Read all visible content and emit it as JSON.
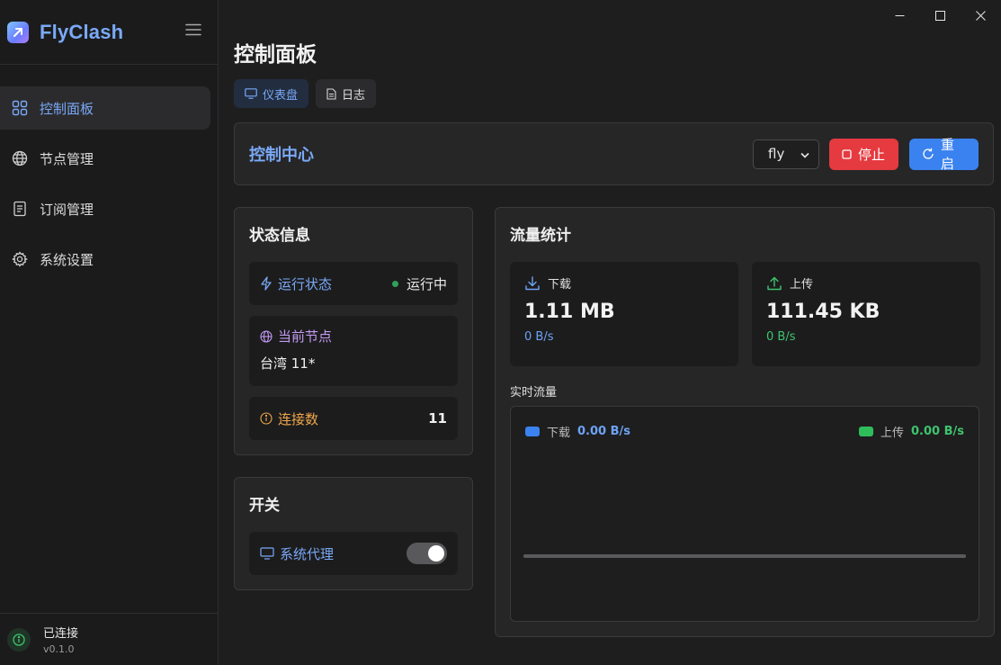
{
  "app": {
    "name": "FlyClash",
    "status": "已连接",
    "version": "v0.1.0"
  },
  "sidebar": {
    "items": [
      {
        "label": "控制面板",
        "icon": "grid-icon",
        "active": true
      },
      {
        "label": "节点管理",
        "icon": "globe-icon"
      },
      {
        "label": "订阅管理",
        "icon": "document-icon"
      },
      {
        "label": "系统设置",
        "icon": "gear-icon"
      }
    ]
  },
  "page": {
    "title": "控制面板"
  },
  "tabs": [
    {
      "label": "仪表盘",
      "active": true
    },
    {
      "label": "日志"
    }
  ],
  "control_center": {
    "title": "控制中心",
    "profile_selected": "fly",
    "stop_label": "停止",
    "restart_label": "重启",
    "colors": {
      "stop": "#e53a3f",
      "restart": "#3a82f0"
    }
  },
  "status": {
    "title": "状态信息",
    "run_state_label": "运行状态",
    "run_state_value": "运行中",
    "current_node_label": "当前节点",
    "current_node_value": "台湾 11*",
    "connections_label": "连接数",
    "connections_value": "11"
  },
  "switches": {
    "title": "开关",
    "system_proxy_label": "系统代理",
    "system_proxy_on": true
  },
  "traffic": {
    "title": "流量统计",
    "download": {
      "label": "下载",
      "total": "1.11 MB",
      "rate": "0 B/s"
    },
    "upload": {
      "label": "上传",
      "total": "111.45 KB",
      "rate": "0 B/s"
    },
    "realtime_label": "实时流量",
    "legend": {
      "download_label": "下载",
      "download_value": "0.00 B/s",
      "upload_label": "上传",
      "upload_value": "0.00 B/s"
    }
  },
  "chart_data": {
    "type": "line",
    "series": [
      {
        "name": "下载",
        "values": [
          0,
          0,
          0,
          0,
          0,
          0,
          0,
          0,
          0,
          0
        ]
      },
      {
        "name": "上传",
        "values": [
          0,
          0,
          0,
          0,
          0,
          0,
          0,
          0,
          0,
          0
        ]
      }
    ],
    "colors": [
      "#3a82f0",
      "#2fbd5c"
    ],
    "grid": false,
    "legend": "top"
  }
}
